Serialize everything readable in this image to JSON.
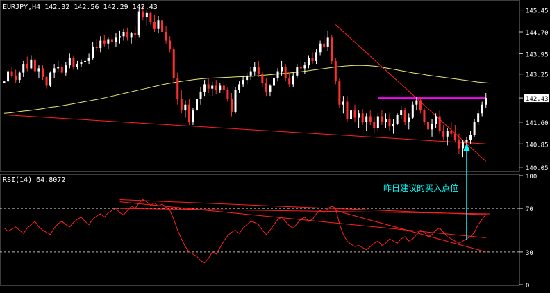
{
  "chart_data": [
    {
      "type": "candlestick",
      "panel": "price",
      "title": "EURJPY,H4  142.32 142.56 142.29 142.43",
      "last_price_label": "142.43",
      "y_ticks": [
        "145.45",
        "144.70",
        "143.95",
        "143.25",
        "142.43",
        "141.60",
        "140.85",
        "140.05"
      ],
      "ylim": [
        139.95,
        145.75
      ],
      "grid": false,
      "colors": {
        "bull": "#ffffff",
        "bear": "#ff3030",
        "ma": "#e8e870",
        "trendline": "#ff2020",
        "resistance": "#ff00ff",
        "annotation": "#00ffff"
      },
      "candles_ohlc": [
        [
          142.95,
          143.0,
          142.95,
          143.0
        ],
        [
          143.0,
          143.45,
          143.3,
          143.35
        ],
        [
          143.35,
          143.5,
          143.1,
          143.2
        ],
        [
          143.2,
          143.4,
          142.95,
          143.05
        ],
        [
          143.05,
          143.35,
          142.95,
          143.3
        ],
        [
          143.3,
          143.7,
          143.15,
          143.6
        ],
        [
          143.6,
          143.85,
          143.35,
          143.45
        ],
        [
          143.45,
          143.9,
          143.4,
          143.75
        ],
        [
          143.75,
          143.8,
          143.3,
          143.35
        ],
        [
          143.35,
          143.55,
          143.1,
          143.45
        ],
        [
          143.45,
          143.55,
          143.05,
          143.15
        ],
        [
          143.15,
          143.2,
          142.75,
          142.85
        ],
        [
          142.85,
          143.35,
          142.8,
          143.3
        ],
        [
          143.3,
          143.6,
          143.1,
          143.45
        ],
        [
          143.45,
          143.7,
          143.35,
          143.5
        ],
        [
          143.5,
          143.6,
          143.25,
          143.3
        ],
        [
          143.3,
          143.65,
          143.2,
          143.55
        ],
        [
          143.55,
          143.95,
          143.45,
          143.8
        ],
        [
          143.8,
          143.9,
          143.4,
          143.5
        ],
        [
          143.5,
          143.7,
          143.4,
          143.6
        ],
        [
          143.6,
          143.75,
          143.5,
          143.65
        ],
        [
          143.65,
          143.8,
          143.55,
          143.7
        ],
        [
          143.7,
          143.95,
          143.6,
          143.8
        ],
        [
          143.8,
          144.35,
          143.75,
          144.2
        ],
        [
          144.2,
          144.45,
          144.05,
          144.15
        ],
        [
          144.15,
          144.55,
          144.0,
          144.4
        ],
        [
          144.4,
          144.6,
          144.2,
          144.3
        ],
        [
          144.3,
          144.5,
          144.1,
          144.45
        ],
        [
          144.45,
          144.6,
          144.25,
          144.35
        ],
        [
          144.35,
          144.65,
          144.2,
          144.5
        ],
        [
          144.5,
          144.75,
          144.3,
          144.55
        ],
        [
          144.55,
          144.8,
          144.4,
          144.7
        ],
        [
          144.7,
          144.85,
          144.4,
          144.5
        ],
        [
          144.5,
          144.7,
          144.3,
          144.65
        ],
        [
          144.65,
          144.9,
          144.45,
          144.6
        ],
        [
          144.6,
          145.55,
          144.5,
          145.4
        ],
        [
          145.4,
          145.6,
          145.1,
          145.2
        ],
        [
          145.2,
          145.45,
          144.9,
          145.35
        ],
        [
          145.35,
          145.4,
          144.95,
          145.05
        ],
        [
          145.05,
          145.3,
          144.7,
          144.8
        ],
        [
          144.8,
          145.25,
          144.65,
          145.1
        ],
        [
          145.1,
          145.2,
          144.6,
          144.7
        ],
        [
          144.7,
          144.9,
          144.3,
          144.4
        ],
        [
          144.4,
          144.55,
          144.0,
          144.1
        ],
        [
          144.1,
          144.2,
          142.9,
          143.1
        ],
        [
          143.1,
          143.3,
          142.2,
          142.4
        ],
        [
          142.4,
          142.7,
          141.9,
          142.0
        ],
        [
          142.0,
          142.35,
          141.75,
          142.2
        ],
        [
          142.2,
          142.4,
          141.5,
          141.6
        ],
        [
          141.6,
          142.1,
          141.5,
          142.0
        ],
        [
          142.0,
          142.5,
          141.9,
          142.4
        ],
        [
          142.4,
          142.8,
          142.2,
          142.65
        ],
        [
          142.65,
          143.05,
          142.5,
          142.9
        ],
        [
          142.9,
          143.1,
          142.6,
          142.75
        ],
        [
          142.75,
          143.0,
          142.5,
          142.85
        ],
        [
          142.85,
          143.05,
          142.55,
          142.7
        ],
        [
          142.7,
          142.95,
          142.6,
          142.85
        ],
        [
          142.85,
          143.0,
          142.6,
          142.7
        ],
        [
          142.7,
          142.8,
          142.3,
          142.4
        ],
        [
          142.4,
          142.6,
          141.8,
          141.95
        ],
        [
          141.95,
          142.8,
          141.9,
          142.7
        ],
        [
          142.7,
          143.0,
          142.6,
          142.9
        ],
        [
          142.9,
          143.2,
          142.8,
          143.05
        ],
        [
          143.05,
          143.3,
          142.9,
          143.2
        ],
        [
          143.2,
          143.5,
          143.05,
          143.35
        ],
        [
          143.35,
          143.65,
          143.2,
          143.5
        ],
        [
          143.5,
          143.7,
          143.15,
          143.25
        ],
        [
          143.25,
          143.35,
          142.8,
          142.95
        ],
        [
          142.95,
          143.1,
          142.5,
          142.65
        ],
        [
          142.65,
          142.9,
          142.5,
          142.85
        ],
        [
          142.85,
          143.25,
          142.7,
          143.1
        ],
        [
          143.1,
          143.45,
          143.0,
          143.35
        ],
        [
          143.35,
          143.7,
          143.2,
          143.5
        ],
        [
          143.5,
          143.6,
          143.0,
          143.1
        ],
        [
          143.1,
          143.3,
          142.8,
          142.9
        ],
        [
          142.9,
          143.3,
          142.8,
          143.2
        ],
        [
          143.2,
          143.6,
          143.1,
          143.5
        ],
        [
          143.5,
          143.75,
          143.3,
          143.45
        ],
        [
          143.45,
          143.65,
          143.25,
          143.55
        ],
        [
          143.55,
          143.9,
          143.45,
          143.8
        ],
        [
          143.8,
          144.0,
          143.6,
          143.7
        ],
        [
          143.7,
          144.1,
          143.6,
          144.0
        ],
        [
          144.0,
          144.4,
          143.9,
          144.3
        ],
        [
          144.3,
          144.55,
          144.1,
          144.2
        ],
        [
          144.2,
          144.75,
          144.05,
          144.5
        ],
        [
          144.5,
          144.6,
          143.6,
          143.7
        ],
        [
          143.7,
          143.8,
          142.9,
          143.0
        ],
        [
          143.0,
          143.1,
          142.1,
          142.2
        ],
        [
          142.2,
          142.5,
          141.9,
          142.3
        ],
        [
          142.3,
          142.5,
          141.6,
          141.7
        ],
        [
          141.7,
          142.1,
          141.45,
          142.0
        ],
        [
          142.0,
          142.2,
          141.6,
          141.75
        ],
        [
          141.75,
          142.0,
          141.4,
          141.9
        ],
        [
          141.9,
          142.05,
          141.5,
          141.6
        ],
        [
          141.6,
          141.9,
          141.3,
          141.8
        ],
        [
          141.8,
          142.0,
          141.5,
          141.6
        ],
        [
          141.6,
          141.8,
          141.2,
          141.4
        ],
        [
          141.4,
          141.9,
          141.3,
          141.8
        ],
        [
          141.8,
          142.0,
          141.5,
          141.6
        ],
        [
          141.6,
          141.9,
          141.4,
          141.7
        ],
        [
          141.7,
          141.9,
          141.3,
          141.45
        ],
        [
          141.45,
          141.7,
          141.2,
          141.55
        ],
        [
          141.55,
          141.9,
          141.5,
          141.85
        ],
        [
          141.85,
          142.15,
          141.7,
          142.0
        ],
        [
          142.0,
          142.1,
          141.5,
          141.6
        ],
        [
          141.6,
          141.9,
          141.35,
          141.75
        ],
        [
          141.75,
          142.3,
          141.7,
          142.2
        ],
        [
          142.2,
          142.48,
          142.0,
          142.35
        ],
        [
          142.35,
          142.45,
          141.9,
          142.0
        ],
        [
          142.0,
          142.1,
          141.5,
          141.6
        ],
        [
          141.6,
          141.8,
          141.2,
          141.35
        ],
        [
          141.35,
          141.7,
          141.1,
          141.55
        ],
        [
          141.55,
          141.9,
          141.4,
          141.8
        ],
        [
          141.8,
          142.0,
          141.2,
          141.3
        ],
        [
          141.3,
          141.5,
          141.0,
          141.1
        ],
        [
          141.1,
          141.4,
          140.8,
          141.3
        ],
        [
          141.3,
          141.6,
          141.1,
          141.2
        ],
        [
          141.2,
          141.5,
          140.9,
          141.0
        ],
        [
          141.0,
          141.2,
          140.5,
          140.7
        ],
        [
          140.7,
          141.0,
          140.4,
          140.9
        ],
        [
          140.9,
          141.1,
          140.2,
          141.0
        ],
        [
          141.0,
          141.3,
          140.85,
          141.15
        ],
        [
          141.15,
          141.7,
          141.1,
          141.6
        ],
        [
          141.6,
          142.0,
          141.5,
          141.9
        ],
        [
          141.9,
          142.3,
          141.8,
          142.2
        ],
        [
          142.2,
          142.6,
          142.1,
          142.43
        ]
      ],
      "ma_values": [
        141.9,
        141.92,
        141.95,
        141.98,
        142.0,
        142.03,
        142.06,
        142.1,
        142.13,
        142.16,
        142.2,
        142.24,
        142.28,
        142.32,
        142.36,
        142.4,
        142.45,
        142.5,
        142.55,
        142.6,
        142.65,
        142.7,
        142.75,
        142.8,
        142.85,
        142.9,
        142.94,
        142.98,
        143.01,
        143.04,
        143.07,
        143.09,
        143.11,
        143.12,
        143.13,
        143.14,
        143.15,
        143.16,
        143.17,
        143.18,
        143.2,
        143.22,
        143.24,
        143.26,
        143.28,
        143.3,
        143.32,
        143.35,
        143.38,
        143.41,
        143.44,
        143.47,
        143.5,
        143.52,
        143.54,
        143.55,
        143.55,
        143.54,
        143.52,
        143.49,
        143.45,
        143.41,
        143.37,
        143.33,
        143.29,
        143.26,
        143.22,
        143.19,
        143.16,
        143.13,
        143.1,
        143.07,
        143.04,
        143.01,
        142.98,
        142.96,
        142.94
      ],
      "ma_start_index": 0,
      "ma_step": 1.66,
      "lines": [
        {
          "name": "lower-trendline",
          "from": [
            0,
            141.85
          ],
          "to": [
            125,
            140.85
          ]
        },
        {
          "name": "downtrend-line",
          "from": [
            86,
            144.95
          ],
          "to": [
            125,
            140.25
          ]
        },
        {
          "name": "resistance-line",
          "from": [
            97,
            142.43
          ],
          "to": [
            125,
            142.43
          ]
        }
      ]
    },
    {
      "type": "line",
      "panel": "indicator",
      "title": "RSI(14) 64.8072",
      "y_ticks": [
        "100",
        "70",
        "30",
        "0"
      ],
      "ylim": [
        0,
        100
      ],
      "levels": [
        70,
        30
      ],
      "annotation": "昨日建议的买入点位",
      "values": [
        52,
        49,
        51,
        53,
        50,
        47,
        52,
        55,
        58,
        53,
        50,
        48,
        46,
        52,
        56,
        58,
        55,
        53,
        57,
        60,
        62,
        58,
        55,
        60,
        63,
        65,
        62,
        66,
        68,
        70,
        66,
        64,
        68,
        72,
        70,
        75,
        78,
        76,
        73,
        75,
        72,
        74,
        71,
        68,
        60,
        50,
        42,
        35,
        30,
        28,
        26,
        22,
        20,
        24,
        30,
        28,
        34,
        40,
        45,
        48,
        50,
        47,
        52,
        55,
        58,
        57,
        55,
        50,
        46,
        50,
        55,
        60,
        62,
        58,
        54,
        52,
        56,
        60,
        62,
        58,
        60,
        65,
        68,
        66,
        70,
        72,
        70,
        56,
        46,
        40,
        37,
        35,
        36,
        34,
        32,
        35,
        38,
        40,
        36,
        38,
        42,
        40,
        38,
        42,
        44,
        40,
        42,
        46,
        50,
        48,
        44,
        46,
        50,
        52,
        48,
        44,
        42,
        40,
        38,
        40,
        42,
        44,
        48,
        55,
        60,
        64.8
      ],
      "lines": [
        {
          "name": "rsi-upper-trendline",
          "from": [
            30,
            78
          ],
          "to": [
            126,
            64
          ]
        },
        {
          "name": "rsi-mid-trendline",
          "from": [
            30,
            76
          ],
          "to": [
            125,
            43
          ]
        },
        {
          "name": "rsi-lower-trendline",
          "from": [
            86,
            68
          ],
          "to": [
            125,
            30
          ]
        },
        {
          "name": "rsi-resistance",
          "from": [
            30,
            70
          ],
          "to": [
            126,
            65
          ]
        }
      ]
    }
  ]
}
